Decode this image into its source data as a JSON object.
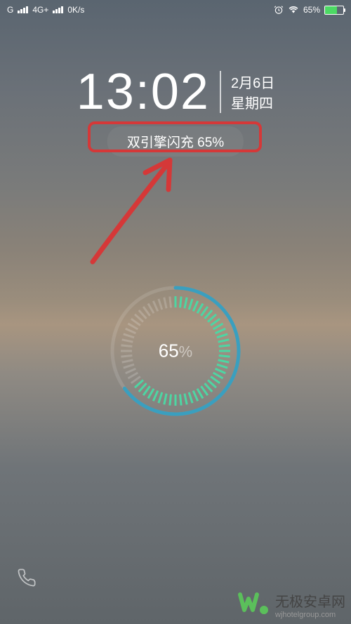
{
  "status": {
    "carrier": "G",
    "network": "4G+",
    "speed": "0K/s",
    "battery_text": "65%",
    "battery_fill_pct": 65
  },
  "clock": {
    "time": "13:02",
    "date": "2月6日",
    "weekday": "星期四"
  },
  "charging": {
    "label": "双引擎闪充 65%",
    "ring_value": "65",
    "ring_pct_symbol": "%",
    "percent": 65
  },
  "watermark": {
    "title": "无极安卓网",
    "url": "wjhotelgroup.com"
  },
  "colors": {
    "annotation": "#d53838",
    "ring_outer": "#3a9fbf",
    "ring_inner_on": "#4dd6a3",
    "battery_charging": "#4cd964"
  }
}
